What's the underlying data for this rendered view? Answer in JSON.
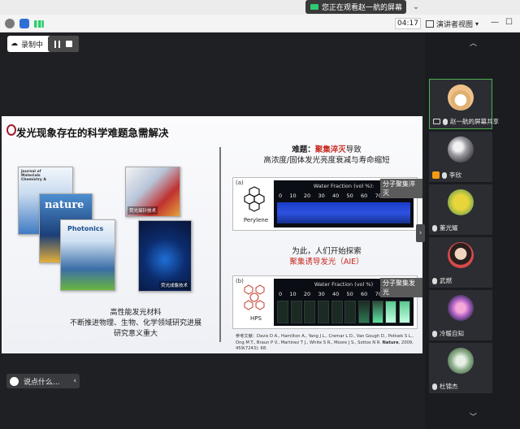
{
  "window": {
    "share_notice": "您正在观看赵一航的屏幕",
    "timer": "04:17",
    "view_mode": "演讲者视图",
    "recording_label": "录制中",
    "chat_placeholder": "说点什么..."
  },
  "slide": {
    "title": "发光现象存在的科学难题急需解决",
    "left_caption": [
      "高性能发光材料",
      "不断推进物理、生物、化学领域研究进展",
      "研究意义重大"
    ],
    "cover_labels": {
      "jmc": "Journal of Materials Chemistry A",
      "nature": "nature",
      "photonics": "Photonics",
      "tag1": "荧光探针技术",
      "tag2": "荧光成像技术"
    },
    "problem_line1_prefix": "难题：",
    "problem_line1_red": "聚集淬灭",
    "problem_line1_suffix": "导致",
    "problem_line2": "高浓度/固体发光亮度衰减与寿命缩短",
    "mid_line1": "为此，人们开始探索",
    "mid_line2": "聚集诱导发光（AIE）",
    "panel_a": {
      "letter": "(a)",
      "molecule": "Perylene",
      "strip_title": "Water Fraction (vol %):",
      "scale": [
        "0",
        "10",
        "20",
        "30",
        "40",
        "50",
        "60",
        "70",
        "80",
        "90"
      ],
      "tag": "分子聚集淬灭"
    },
    "panel_b": {
      "letter": "(b)",
      "molecule": "HPS",
      "strip_title": "Water Fraction (vol %)",
      "scale": [
        "0",
        "10",
        "20",
        "30",
        "40",
        "50",
        "60",
        "70",
        "80",
        "90"
      ],
      "tag": "分子聚集发光"
    },
    "reference_prefix": "参考文献：",
    "reference": "Davis D A., Hamilton A., Yang J L., Cremar L D., Van Gough D., Potisek S L., Ong M T., Braun P V., Martinez T J., White S R., Moore J S., Sottos N R.",
    "reference_journal": "Nature",
    "reference_suffix": ", 2009, 459(7243): 68."
  },
  "participants": [
    {
      "name": "赵一航的屏幕共享",
      "icon": "screen-share-icon",
      "color": "#f0c28a",
      "active": true
    },
    {
      "name": "李欣",
      "icon": "host-icon",
      "color": "#9a9aa0",
      "active": false
    },
    {
      "name": "董光耀",
      "icon": "mic-muted-icon",
      "color": "#c9d24a",
      "active": false
    },
    {
      "name": "武燃",
      "icon": "mic-muted-icon",
      "color": "#d94a4a",
      "active": false
    },
    {
      "name": "冷暖自知",
      "icon": "mic-muted-icon",
      "color": "#b766c9",
      "active": false
    },
    {
      "name": "杜锦杰",
      "icon": "mic-muted-icon",
      "color": "#8fb08e",
      "active": false
    }
  ]
}
